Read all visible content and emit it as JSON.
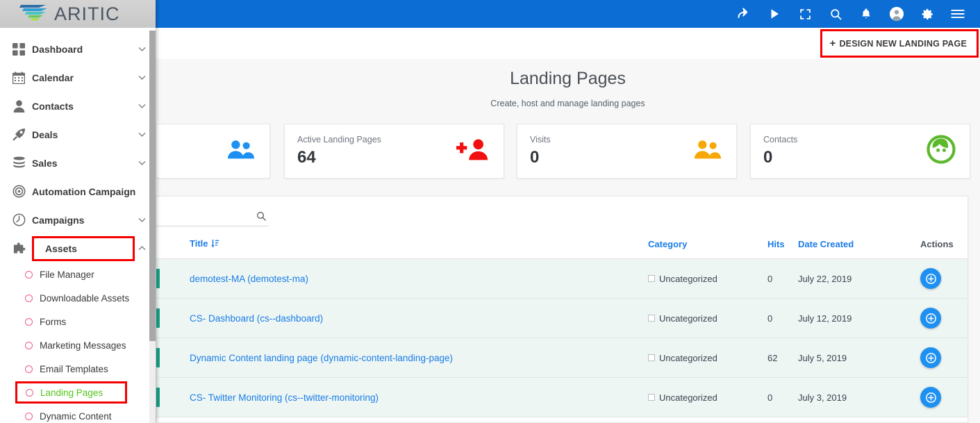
{
  "brand": {
    "name": "ARITIC",
    "logo_icon": "aritic-wing-logo"
  },
  "topbar": {
    "background": "#0c6dd4",
    "icons": [
      {
        "name": "share-icon",
        "label": "Share"
      },
      {
        "name": "play-icon",
        "label": "Run"
      },
      {
        "name": "fullscreen-icon",
        "label": "Fullscreen"
      },
      {
        "name": "search-icon",
        "label": "Search"
      },
      {
        "name": "bell-icon",
        "label": "Notifications"
      },
      {
        "name": "user-avatar-icon",
        "label": "Account"
      },
      {
        "name": "gear-icon",
        "label": "Settings"
      },
      {
        "name": "hamburger-menu-icon",
        "label": "Menu"
      }
    ]
  },
  "actionbar": {
    "design_button_label": "DESIGN NEW LANDING PAGE",
    "design_button_plus": "+",
    "highlight_color": "#f50000"
  },
  "page": {
    "title": "Landing Pages",
    "subtitle": "Create, host and manage landing pages"
  },
  "cards": [
    {
      "label": "",
      "value": "",
      "icon": "two-people-icon",
      "icon_color": "#1e90f2"
    },
    {
      "label": "Active Landing Pages",
      "value": "64",
      "icon": "add-person-icon",
      "icon_color": "#f20f0f"
    },
    {
      "label": "Visits",
      "value": "0",
      "icon": "two-people-icon",
      "icon_color": "#f7a707"
    },
    {
      "label": "Contacts",
      "value": "0",
      "icon": "contact-face-icon",
      "icon_color": "#5cb82d"
    }
  ],
  "search": {
    "value": "",
    "placeholder": "",
    "icon": "search-icon"
  },
  "table": {
    "columns": {
      "check": "",
      "title": "Title",
      "category": "Category",
      "hits": "Hits",
      "date": "Date Created",
      "actions": "Actions"
    },
    "sort_indicator_icon": "sort-descending-icon",
    "rows": [
      {
        "title": "demotest-MA (demotest-ma)",
        "category": "Uncategorized",
        "hits": "0",
        "date": "July 22, 2019",
        "action_icon": "add-circle-icon",
        "status_color": "#19a186"
      },
      {
        "title": "CS- Dashboard (cs--dashboard)",
        "category": "Uncategorized",
        "hits": "0",
        "date": "July 12, 2019",
        "action_icon": "add-circle-icon",
        "status_color": "#19a186"
      },
      {
        "title": "Dynamic Content landing page (dynamic-content-landing-page)",
        "category": "Uncategorized",
        "hits": "62",
        "date": "July 5, 2019",
        "action_icon": "add-circle-icon",
        "status_color": "#19a186"
      },
      {
        "title": "CS- Twitter Monitoring (cs--twitter-monitoring)",
        "category": "Uncategorized",
        "hits": "0",
        "date": "July 3, 2019",
        "action_icon": "add-circle-icon",
        "status_color": "#19a186"
      }
    ]
  },
  "sidebar": {
    "items": [
      {
        "label": "Dashboard",
        "icon": "grid-icon",
        "chevron": "chevron-down",
        "boxed": false
      },
      {
        "label": "Calendar",
        "icon": "calendar-icon",
        "chevron": "chevron-down",
        "boxed": false
      },
      {
        "label": "Contacts",
        "icon": "person-icon",
        "chevron": "chevron-down",
        "boxed": false
      },
      {
        "label": "Deals",
        "icon": "rocket-icon",
        "chevron": "chevron-down",
        "boxed": false
      },
      {
        "label": "Sales",
        "icon": "database-icon",
        "chevron": "chevron-down",
        "boxed": false
      },
      {
        "label": "Automation Campaign",
        "icon": "target-icon",
        "chevron": "none",
        "boxed": false
      },
      {
        "label": "Campaigns",
        "icon": "clock-icon",
        "chevron": "chevron-down",
        "boxed": false
      },
      {
        "label": "Assets",
        "icon": "puzzle-icon",
        "chevron": "chevron-up",
        "boxed": true
      }
    ],
    "subitems": [
      {
        "label": "File Manager",
        "active": false
      },
      {
        "label": "Downloadable Assets",
        "active": false
      },
      {
        "label": "Forms",
        "active": false
      },
      {
        "label": "Marketing Messages",
        "active": false
      },
      {
        "label": "Email Templates",
        "active": false
      },
      {
        "label": "Landing Pages",
        "active": true
      },
      {
        "label": "Dynamic Content",
        "active": false
      }
    ],
    "active_color": "#52c41a",
    "highlight_color": "#f50000"
  }
}
